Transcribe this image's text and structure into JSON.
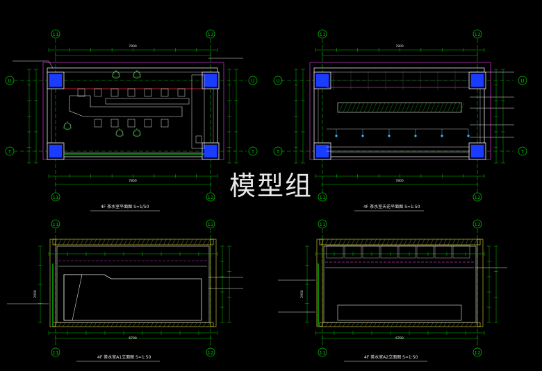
{
  "watermark": "模型组",
  "grid_labels": {
    "col_left": "11",
    "col_right": "12",
    "row_top": "U",
    "row_bottom": "T"
  },
  "panels": {
    "plan_floor": {
      "title": "4F 茶水室平面图 S=1/50",
      "scale": "1/50"
    },
    "plan_ceiling": {
      "title": "4F 茶水室天花平面图 S=1:50",
      "scale": "1:50"
    },
    "elev_a": {
      "title": "4F 茶水室A1立面图 S=1:50",
      "tag": "A1"
    },
    "elev_b": {
      "title": "4F 茶水室A2立面图 S=1:50",
      "tag": "A2"
    }
  },
  "dims": {
    "plan_top_total": "7800",
    "plan_bottom_total": "7800",
    "plan_left": "3030",
    "elev_width": "6700",
    "elev_height": "2950"
  },
  "colors": {
    "background": "#000000",
    "grid": "#00c000",
    "magenta": "#c030c0",
    "blue": "#1a3cff",
    "white": "#e8e8e8",
    "red": "#ff3030",
    "cyan": "#40c0ff",
    "yellow": "#e0e040"
  }
}
